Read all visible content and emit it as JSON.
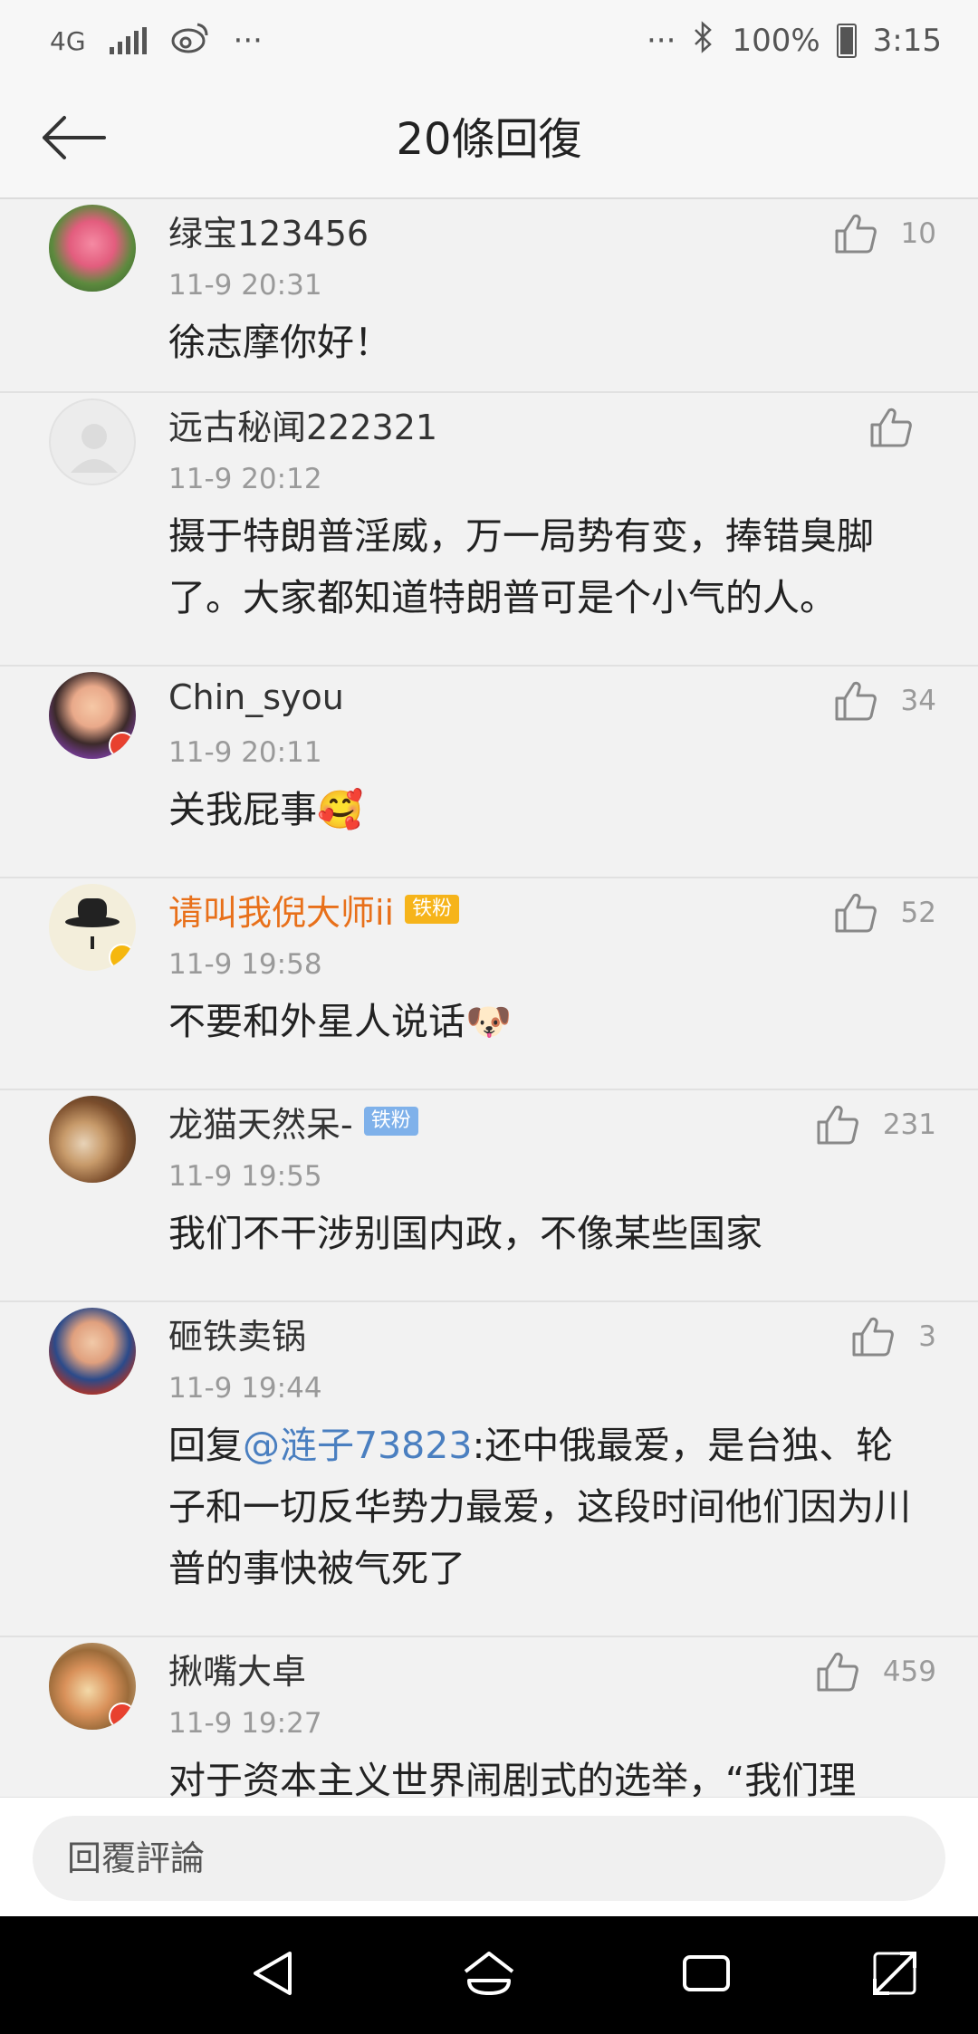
{
  "status_bar": {
    "network": "4G",
    "more": "···",
    "more_right": "···",
    "battery": "100%",
    "time": "3:15"
  },
  "header": {
    "title": "20條回復"
  },
  "comments": [
    {
      "user": "绿宝123456",
      "time": "11-9 20:31",
      "likes": "10",
      "text": "徐志摩你好！"
    },
    {
      "user": "远古秘闻222321",
      "time": "11-9 20:12",
      "likes": "",
      "text": "摄于特朗普淫威，万一局势有变，捧错臭脚了。大家都知道特朗普可是个小气的人。"
    },
    {
      "user": "Chin_syou",
      "time": "11-9 20:11",
      "likes": "34",
      "text": "关我屁事",
      "emoji": "🥰"
    },
    {
      "user": "请叫我倪大师ii",
      "tag": "铁粉",
      "time": "11-9 19:58",
      "likes": "52",
      "text": "不要和外星人说话",
      "emoji": "🐶"
    },
    {
      "user": "龙猫天然呆-",
      "tag": "铁粉",
      "time": "11-9 19:55",
      "likes": "231",
      "text": "我们不干涉别国内政，不像某些国家"
    },
    {
      "user": "砸铁卖锅",
      "time": "11-9 19:44",
      "likes": "3",
      "reply_prefix": "回复",
      "mention": "@涟子73823",
      "text": ":还中俄最爱，是台独、轮子和一切反华势力最爱，这段时间他们因为川普的事快被气死了"
    },
    {
      "user": "揪嘴大卓",
      "time": "11-9 19:27",
      "likes": "459",
      "text": "对于资本主义世界闹剧式的选举，“我们理"
    }
  ],
  "reply_bar": {
    "placeholder": "回覆評論"
  },
  "icons": {
    "back": "arrow-left-icon",
    "like": "thumbs-up-icon",
    "nav_back": "triangle-back-icon",
    "nav_home": "home-icon",
    "nav_recent": "recent-apps-icon",
    "nav_expand": "expand-icon"
  },
  "colors": {
    "vip_name": "#e8701a",
    "mention": "#4a7fc0",
    "tag_gold": "#f6b41a",
    "tag_blue": "#7fb1ea"
  }
}
